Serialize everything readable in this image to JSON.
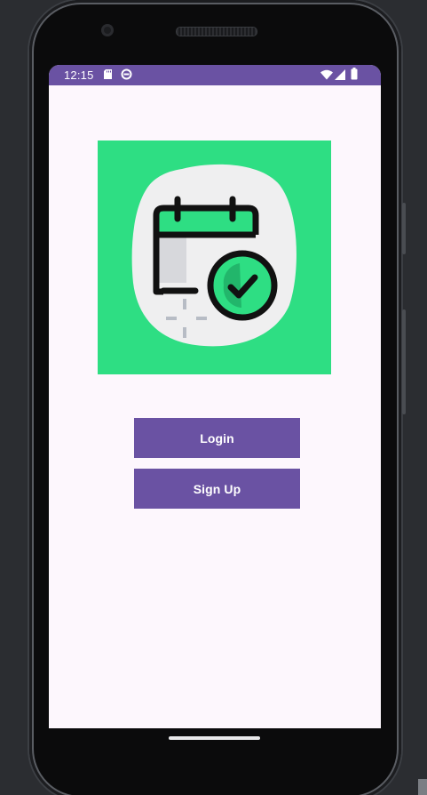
{
  "status_bar": {
    "time": "12:15",
    "left_icons": [
      "sd-card-icon",
      "sync-icon"
    ],
    "right_icons": [
      "wifi-icon",
      "signal-icon",
      "battery-icon"
    ],
    "color": "#6a52a3"
  },
  "main": {
    "logo_icon": "calendar-check-icon",
    "logo_background": "#2ede83",
    "login_label": "Login",
    "signup_label": "Sign Up",
    "button_color": "#6a52a3"
  },
  "theme": {
    "screen_background": "#fdf7fd"
  }
}
